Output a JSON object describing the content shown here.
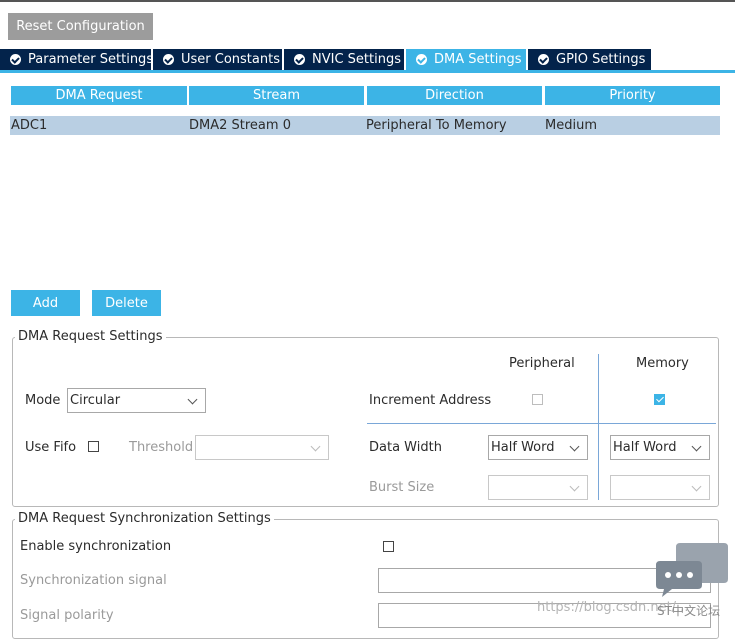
{
  "toolbar": {
    "reset_label": "Reset Configuration"
  },
  "tabs": [
    {
      "label": "Parameter Settings",
      "active": false
    },
    {
      "label": "User Constants",
      "active": false
    },
    {
      "label": "NVIC Settings",
      "active": false
    },
    {
      "label": "DMA Settings",
      "active": true
    },
    {
      "label": "GPIO Settings",
      "active": false
    }
  ],
  "dma_table": {
    "columns": [
      "DMA Request",
      "Stream",
      "Direction",
      "Priority"
    ],
    "rows": [
      {
        "request": "ADC1",
        "stream": "DMA2 Stream 0",
        "direction": "Peripheral To Memory",
        "priority": "Medium"
      }
    ]
  },
  "actions": {
    "add_label": "Add",
    "delete_label": "Delete"
  },
  "request_settings": {
    "title": "DMA Request Settings",
    "peripheral_header": "Peripheral",
    "memory_header": "Memory",
    "mode_label": "Mode",
    "mode_value": "Circular",
    "increment_label": "Increment Address",
    "increment_peripheral": false,
    "increment_memory": true,
    "use_fifo_label": "Use Fifo",
    "use_fifo": false,
    "threshold_label": "Threshold",
    "threshold_value": "",
    "data_width_label": "Data Width",
    "data_width_peripheral": "Half Word",
    "data_width_memory": "Half Word",
    "burst_size_label": "Burst Size",
    "burst_peripheral": "",
    "burst_memory": ""
  },
  "sync_settings": {
    "title": "DMA Request Synchronization Settings",
    "enable_label": "Enable synchronization",
    "enable": false,
    "signal_label": "Synchronization signal",
    "signal_value": "",
    "polarity_label": "Signal polarity",
    "polarity_value": ""
  },
  "overlay": {
    "watermark": "https://blog.csdn.net/...",
    "logo_text": "ST中文论坛"
  },
  "colors": {
    "accent": "#3cb4e6",
    "tab_dark": "#03234b",
    "row_selected": "#b9cfe3"
  }
}
